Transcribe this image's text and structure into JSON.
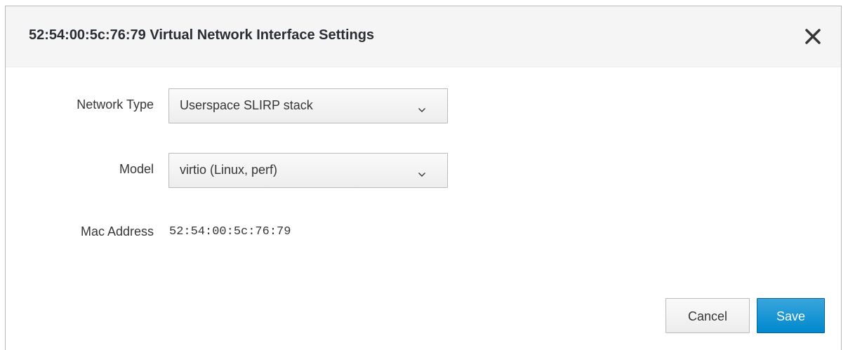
{
  "dialog": {
    "title": "52:54:00:5c:76:79 Virtual Network Interface Settings"
  },
  "form": {
    "network_type": {
      "label": "Network Type",
      "selected": "Userspace SLIRP stack"
    },
    "model": {
      "label": "Model",
      "selected": "virtio (Linux, perf)"
    },
    "mac_address": {
      "label": "Mac Address",
      "value": "52:54:00:5c:76:79"
    }
  },
  "footer": {
    "cancel_label": "Cancel",
    "save_label": "Save"
  },
  "colors": {
    "primary": "#0088ce",
    "header_bg": "#f5f5f5"
  },
  "icons": {
    "close": "close-icon",
    "caret": "chevron-down-icon"
  }
}
